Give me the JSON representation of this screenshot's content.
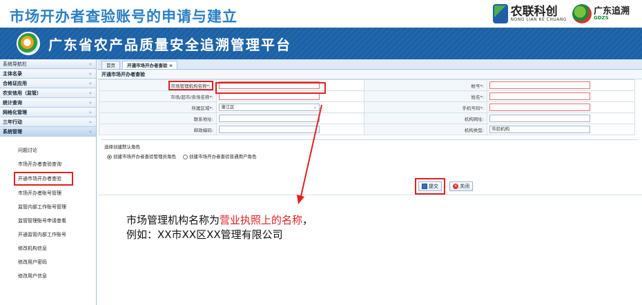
{
  "slide": {
    "title": "市场开办者查验账号的申请与建立"
  },
  "logos": {
    "brand_main": "农联科创",
    "brand_sub": "NONG LIAN KE CHUANG",
    "trace_main": "广东追溯",
    "trace_sub": "GDZS"
  },
  "banner": {
    "title": "广东省农产品质量安全追溯管理平台"
  },
  "sidebar": {
    "header": "系统导航栏",
    "header_chev": "«",
    "items": [
      {
        "label": "主体名录",
        "chev": "»"
      },
      {
        "label": "合格证应用",
        "chev": "»"
      },
      {
        "label": "农安信用（监管）",
        "chev": "»"
      },
      {
        "label": "统计查询",
        "chev": "»"
      },
      {
        "label": "网格化管理",
        "chev": "»"
      },
      {
        "label": "三年行动",
        "chev": "»"
      },
      {
        "label": "系统管理",
        "chev": "«"
      }
    ],
    "sub_items": [
      "问题讨论",
      "市场开办者查验查询",
      "开通市场开办者查验",
      "市场开办者账号管理",
      "监管内部工作账号管理",
      "监管管理账号申请查看",
      "开通监管内部工作账号",
      "修改机构信息",
      "修改用户密码",
      "修改用户信息"
    ]
  },
  "tabs": [
    {
      "label": "首页"
    },
    {
      "label": "开通市场开办者查验 ×"
    }
  ],
  "panel": {
    "title": "开通市场开办者查验"
  },
  "form": {
    "rows": [
      {
        "left_label": "市场管理机构名称*:",
        "left_value": "",
        "right_label": "帐号*:",
        "right_value": ""
      },
      {
        "left_label": "市场/超市/卖场名称*:",
        "left_value": "",
        "right_label": "姓名*:",
        "right_value": ""
      },
      {
        "left_label": "所属区域*:",
        "left_value": "濠江区",
        "right_label": "手机号码*:",
        "right_value": ""
      },
      {
        "left_label": "联系地址:",
        "left_value": "",
        "right_label": "机构网址:",
        "right_value": ""
      },
      {
        "left_label": "邮政编码:",
        "left_value": "",
        "right_label": "机构类型:",
        "right_value": "市验机构"
      }
    ]
  },
  "roles": {
    "title": "选择创建默认角色",
    "options": [
      {
        "label": "创建市场开办者查验管理员角色"
      },
      {
        "label": "创建市场开办者查验普通用户角色"
      }
    ]
  },
  "buttons": {
    "submit": "提交",
    "close": "关闭"
  },
  "note": {
    "line1_prefix": "市场管理机构名称为",
    "line1_highlight": "营业执照上的名称",
    "line1_suffix": "，",
    "line2": "例如：XX市XX区XX管理有限公司"
  },
  "colors": {
    "banner": "#1d5fa3",
    "title": "#2a7fc4",
    "highlight": "#e02020"
  }
}
